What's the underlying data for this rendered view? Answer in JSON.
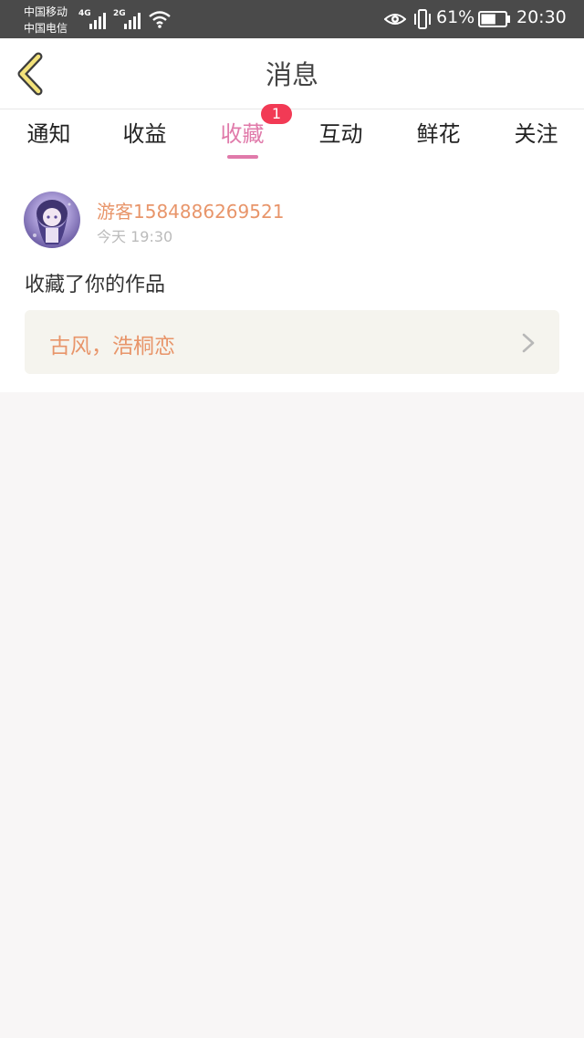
{
  "status_bar": {
    "carrier1": "中国移动",
    "carrier2": "中国电信",
    "net1": "4G",
    "net2": "2G",
    "battery_pct": "61%",
    "battery_level": 0.61,
    "time": "20:30"
  },
  "header": {
    "title": "消息"
  },
  "tabs": [
    {
      "label": "通知"
    },
    {
      "label": "收益"
    },
    {
      "label": "收藏"
    },
    {
      "label": "互动"
    },
    {
      "label": "鲜花"
    },
    {
      "label": "关注"
    }
  ],
  "active_tab": "收藏",
  "badge": {
    "count": "1"
  },
  "message": {
    "username": "游客1584886269521",
    "timestamp": "今天 19:30",
    "action": "收藏了你的作品",
    "work_title": "古风，浩桐恋"
  },
  "colors": {
    "accent_pink": "#e07aaa",
    "badge_red": "#f23a55",
    "name_orange": "#e8956a",
    "back_arrow_yellow": "#f3e27a",
    "card_bg": "#f5f4ee",
    "page_bg": "#f8f6f6"
  },
  "icons": {
    "back": "back-arrow-icon",
    "chevron": "chevron-right-icon",
    "eye": "eye-icon",
    "vibrate": "vibrate-icon",
    "wifi": "wifi-icon",
    "battery": "battery-icon"
  }
}
